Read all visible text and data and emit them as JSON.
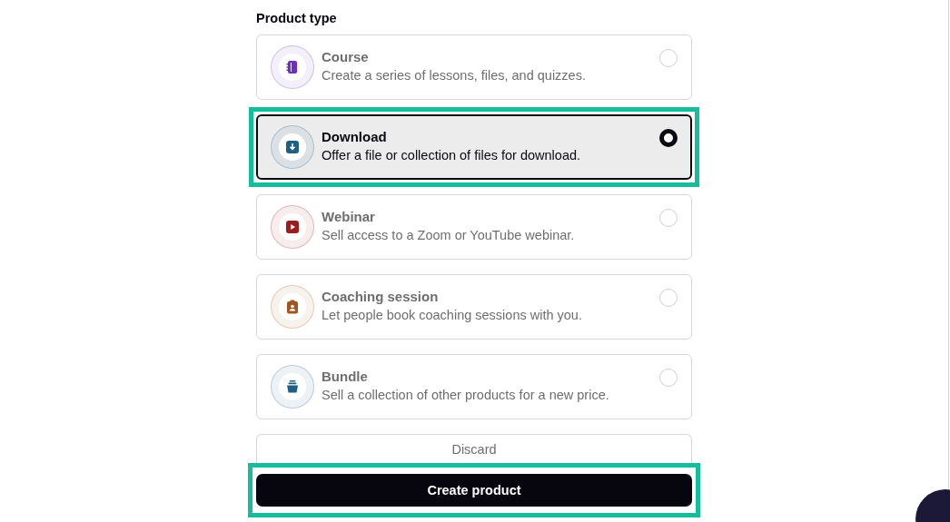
{
  "heading": "Product type",
  "product_types": [
    {
      "kind": "course",
      "title": "Course",
      "description": "Create a series of lessons, files, and quizzes.",
      "color": "#6a2fc7",
      "selected": false,
      "highlighted": false
    },
    {
      "kind": "download",
      "title": "Download",
      "description": "Offer a file or collection of files for download.",
      "color": "#1f5f86",
      "selected": true,
      "highlighted": true
    },
    {
      "kind": "webinar",
      "title": "Webinar",
      "description": "Sell access to a Zoom or YouTube webinar.",
      "color": "#9b1c1c",
      "selected": false,
      "highlighted": false
    },
    {
      "kind": "coaching",
      "title": "Coaching session",
      "description": "Let people book coaching sessions with you.",
      "color": "#a0561c",
      "selected": false,
      "highlighted": false
    },
    {
      "kind": "bundle",
      "title": "Bundle",
      "description": "Sell a collection of other products for a new price.",
      "color": "#1f5f86",
      "selected": false,
      "highlighted": false
    }
  ],
  "discard_button": {
    "label": "Discard"
  },
  "create_button": {
    "label": "Create product",
    "highlighted": true
  }
}
